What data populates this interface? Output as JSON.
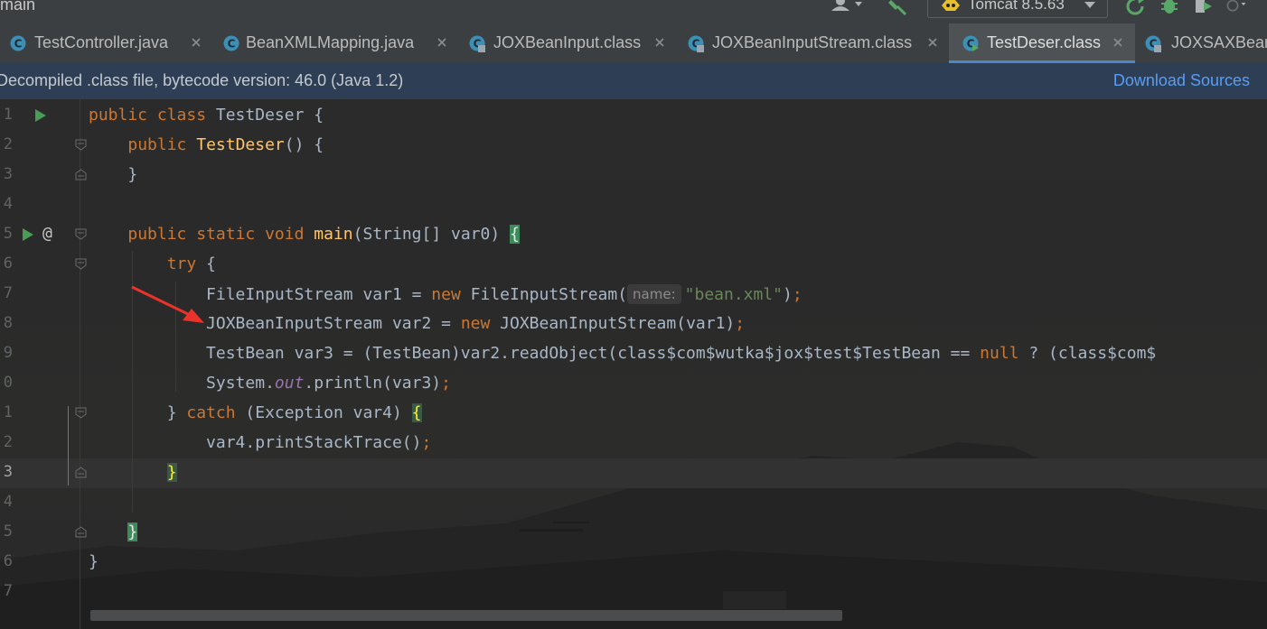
{
  "toolbar": {
    "branch": "main",
    "run_config": "Tomcat 8.5.63",
    "icons": [
      "user-icon",
      "build-hammer-icon",
      "tomcat-icon",
      "rerun-icon",
      "debug-icon",
      "coverage-icon",
      "profile-icon"
    ]
  },
  "tabs": [
    {
      "label": "TestController.java",
      "active": false
    },
    {
      "label": "BeanXMLMapping.java",
      "active": false
    },
    {
      "label": "JOXBeanInput.class",
      "active": false
    },
    {
      "label": "JOXBeanInputStream.class",
      "active": false
    },
    {
      "label": "TestDeser.class",
      "active": true
    },
    {
      "label": "JOXSAXBear",
      "active": false
    }
  ],
  "banner": {
    "message": "Decompiled .class file, bytecode version: 46.0 (Java 1.2)",
    "link": "Download Sources"
  },
  "editor": {
    "line_numbers": [
      "1",
      "2",
      "3",
      "4",
      "5",
      "6",
      "7",
      "8",
      "9",
      "0",
      "1",
      "2",
      "3",
      "4",
      "5",
      "6",
      "7"
    ],
    "current_line_index": 12,
    "param_hint": "name:",
    "lines": {
      "l1_kw": "public class",
      "l1_rest": " TestDeser {",
      "l2_kw": "public",
      "l2_fn": "TestDeser",
      "l2_rest": "() {",
      "l3": "}",
      "l5_kw": "public static void",
      "l5_fn": "main",
      "l5_rest": "(String[] var0) ",
      "l5_brace": "{",
      "l6_kw": "try",
      "l6_rest": " {",
      "l7_a": "FileInputStream var1 = ",
      "l7_kw": "new",
      "l7_b": " FileInputStream(",
      "l7_str": "\"bean.xml\"",
      "l7_c": ")",
      "l7_semi": ";",
      "l8_a": "JOXBeanInputStream var2 = ",
      "l8_kw": "new",
      "l8_b": " JOXBeanInputStream(var1)",
      "l8_semi": ";",
      "l9_a": "TestBean var3 = (TestBean)var2.readObject(class$com$wutka$jox$test$TestBean == ",
      "l9_kw": "null",
      "l9_b": " ? (class$com$",
      "l10_a": "System.",
      "l10_static": "out",
      "l10_b": ".println(var3)",
      "l10_semi": ";",
      "l11_a": "} ",
      "l11_kw": "catch",
      "l11_b": " (Exception var4) ",
      "l11_brace": "{",
      "l12_a": "var4.printStackTrace()",
      "l12_semi": ";",
      "l13_brace": "}",
      "l15_brace": "}",
      "l16": "}"
    }
  },
  "colors": {
    "keyword": "#cc7832",
    "method": "#ffc66d",
    "string": "#6a8759",
    "static_field": "#9876aa",
    "link": "#589df6",
    "annotation_arrow": "#e8322a"
  }
}
